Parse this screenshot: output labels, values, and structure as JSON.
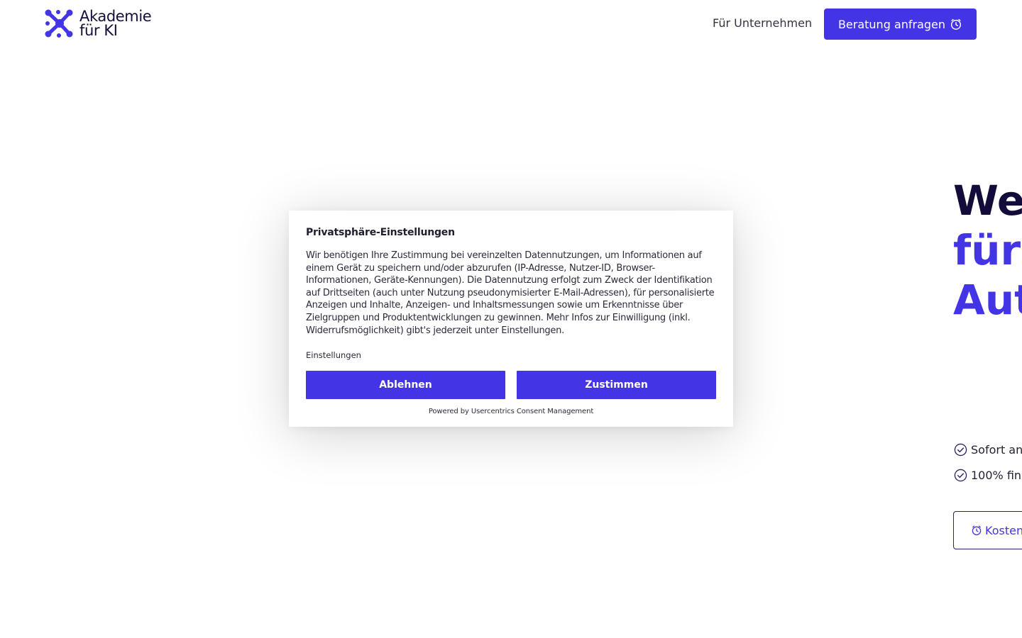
{
  "header": {
    "logo_line1": "Akademie",
    "logo_line2": "für KI",
    "nav_link": "Für Unternehmen",
    "cta_label": "Beratung anfragen",
    "cta_icon": "clock-icon"
  },
  "hero": {
    "line1": "We",
    "line2": "für",
    "line3": "Aut",
    "features": [
      "Sofort an",
      "100% fin"
    ],
    "feature_icon": "check-circle-icon",
    "button_label": "Kosten"
  },
  "consent": {
    "title": "Privatsphäre-Einstellungen",
    "body": "Wir benötigen Ihre Zustimmung bei vereinzelten Datennutzungen, um Informationen auf einem Gerät zu speichern und/oder abzurufen (IP-Adresse, Nutzer-ID, Browser-Informationen, Geräte-Kennungen). Die Datennutzung erfolgt zum Zweck der Identifikation auf Drittseiten (auch unter Nutzung pseudonymisierter E-Mail-Adressen), für personalisierte Anzeigen und Inhalte, Anzeigen- und Inhaltsmessungen sowie um Erkenntnisse über Zielgruppen und Produktentwicklungen zu gewinnen. Mehr Infos zur Einwilligung (inkl. Widerrufsmöglichkeit) gibt's jederzeit unter Einstellungen.",
    "settings_link": "Einstellungen",
    "decline_label": "Ablehnen",
    "accept_label": "Zustimmen",
    "powered_by": "Powered by Usercentrics Consent Management"
  },
  "colors": {
    "brand": "#4334e6",
    "dark": "#110c3a"
  }
}
